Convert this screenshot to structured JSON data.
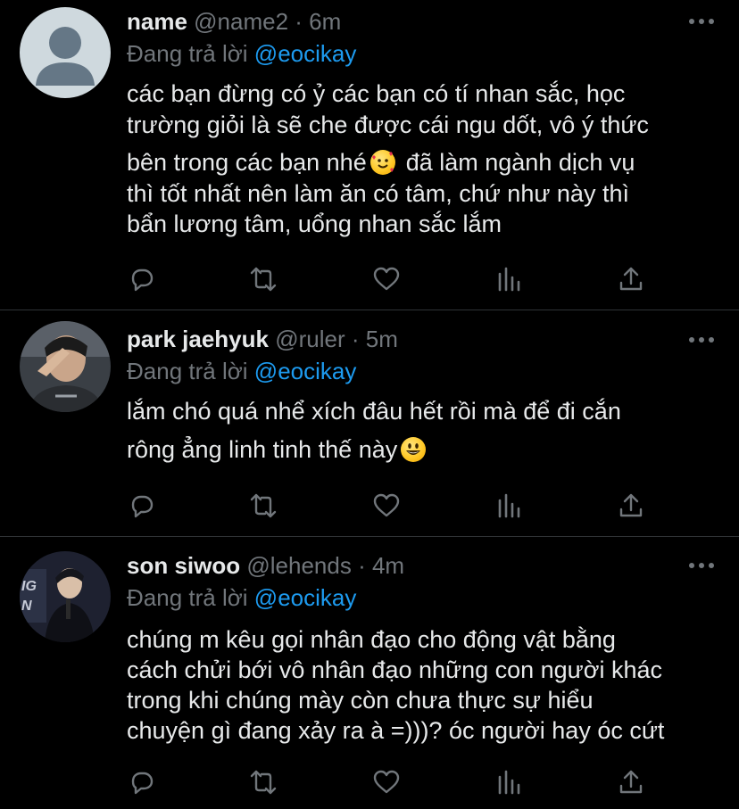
{
  "tweets": [
    {
      "display_name": "name",
      "handle": "@name2",
      "time": "6m",
      "reply_prefix": "Đang trả lời",
      "reply_to": "@eocikay",
      "lines": [
        "các bạn đừng có ỷ các bạn có tí nhan sắc, học",
        "trường giỏi là sẽ che được cái ngu dốt, vô ý thức",
        "bên trong các bạn nhé",
        "đã làm ngành dịch vụ",
        "thì tốt nhất nên làm ăn có tâm, chứ như này thì",
        "bẩn lương tâm, uổng nhan sắc lắm"
      ],
      "avatar": "default-avatar"
    },
    {
      "display_name": "park jaehyuk",
      "handle": "@ruler",
      "time": "5m",
      "reply_prefix": "Đang trả lời",
      "reply_to": "@eocikay",
      "lines": [
        "lắm chó quá nhể xích đâu hết rồi mà để đi cắn",
        "rông ẳng linh tinh thế này"
      ],
      "avatar": "photo-avatar"
    },
    {
      "display_name": "son siwoo",
      "handle": "@lehends",
      "time": "4m",
      "reply_prefix": "Đang trả lời",
      "reply_to": "@eocikay",
      "lines": [
        "chúng m kêu gọi nhân đạo cho động vật bằng",
        "cách chửi bới vô nhân đạo những con người khác",
        "trong khi chúng mày còn chưa thực sự hiểu",
        "chuyện gì đang xảy ra à =)))? óc người hay óc cứt"
      ],
      "avatar": "photo-avatar"
    }
  ],
  "separator": " · ",
  "colors": {
    "background": "#000000",
    "text": "#e7e9ea",
    "muted": "#71767b",
    "accent": "#1d9bf0",
    "divider": "#2f3336"
  },
  "icons": [
    "reply-icon",
    "retweet-icon",
    "like-icon",
    "stats-icon",
    "share-icon",
    "more-icon"
  ]
}
